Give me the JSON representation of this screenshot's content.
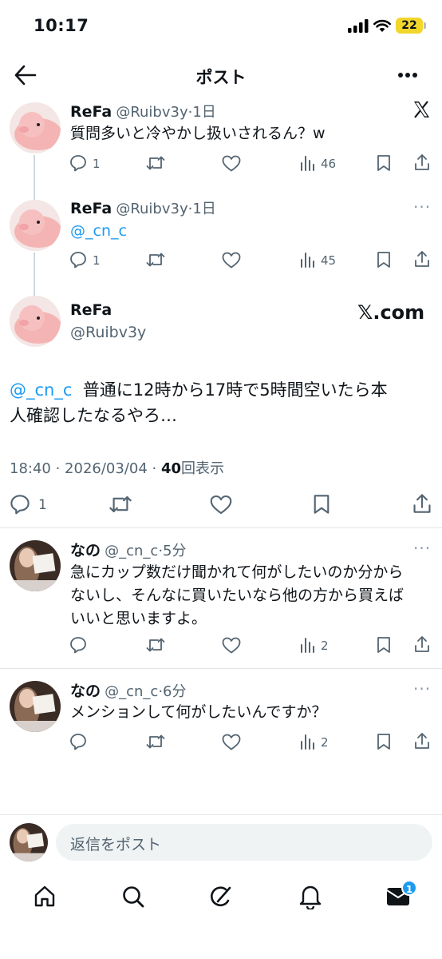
{
  "status_bar": {
    "time": "10:17",
    "battery": "22"
  },
  "header": {
    "title": "ポスト"
  },
  "brand": {
    "x_com": "𝕏.com"
  },
  "tweets": [
    {
      "name": "ReFa",
      "handle": "@Ruibv3y",
      "age": "·1日",
      "text": "質問多いと冷やかし扱いされるん？w",
      "replies": "1",
      "views": "46"
    },
    {
      "name": "ReFa",
      "handle": "@Ruibv3y",
      "age": "·1日",
      "mention": "@_cn_c",
      "replies": "1",
      "views": "45"
    }
  ],
  "main_post": {
    "name": "ReFa",
    "handle": "@Ruibv3y",
    "mention": "@_cn_c",
    "text_line1": "普通に12時から17時で5時間空いたら本",
    "text_line2": "人確認したなるやろ…",
    "timestamp": "18:40 · 2026/03/04 · ",
    "views_count": "40",
    "views_label": "回表示",
    "replies": "1"
  },
  "replies": [
    {
      "name": "なの",
      "handle": "@_cn_c",
      "age": "·5分",
      "line1": "急にカップ数だけ聞かれて何がしたいのか分から",
      "line2": "ないし、そんなに買いたいなら他の方から買えば",
      "line3": "いいと思いますよ。",
      "views": "2"
    },
    {
      "name": "なの",
      "handle": "@_cn_c",
      "age": "·6分",
      "line1": "メンションして何がしたいんですか？",
      "views": "2"
    }
  ],
  "composer": {
    "placeholder": "返信をポスト"
  },
  "nav": {
    "messages_badge": "1"
  },
  "colors": {
    "accent": "#1d9bf0",
    "muted": "#536471",
    "battery": "#f2d62a"
  }
}
